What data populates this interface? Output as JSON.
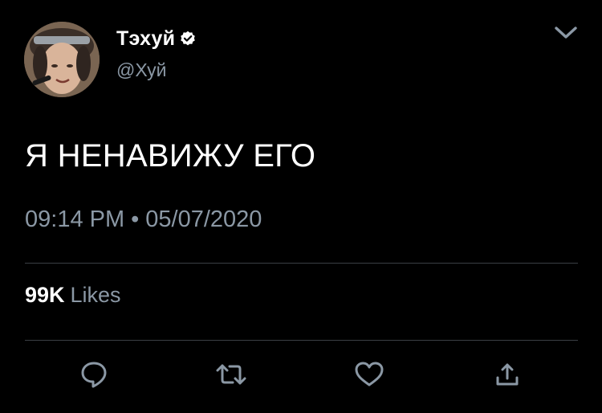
{
  "tweet": {
    "author": {
      "display_name": "Тэхуй",
      "handle": "@Хуй",
      "verified": true
    },
    "text": "Я НЕНАВИЖУ ЕГО",
    "time": "09:14 PM",
    "separator": "•",
    "date": "05/07/2020",
    "likes_count": "99K",
    "likes_label": "Likes"
  },
  "icons": {
    "menu": "chevron-down-icon",
    "verified": "verified-badge-icon",
    "reply": "reply-icon",
    "retweet": "retweet-icon",
    "like": "heart-icon",
    "share": "share-icon"
  },
  "colors": {
    "background": "#000000",
    "text_primary": "#ffffff",
    "text_secondary": "#8b98a5",
    "divider": "#3a3f44"
  }
}
